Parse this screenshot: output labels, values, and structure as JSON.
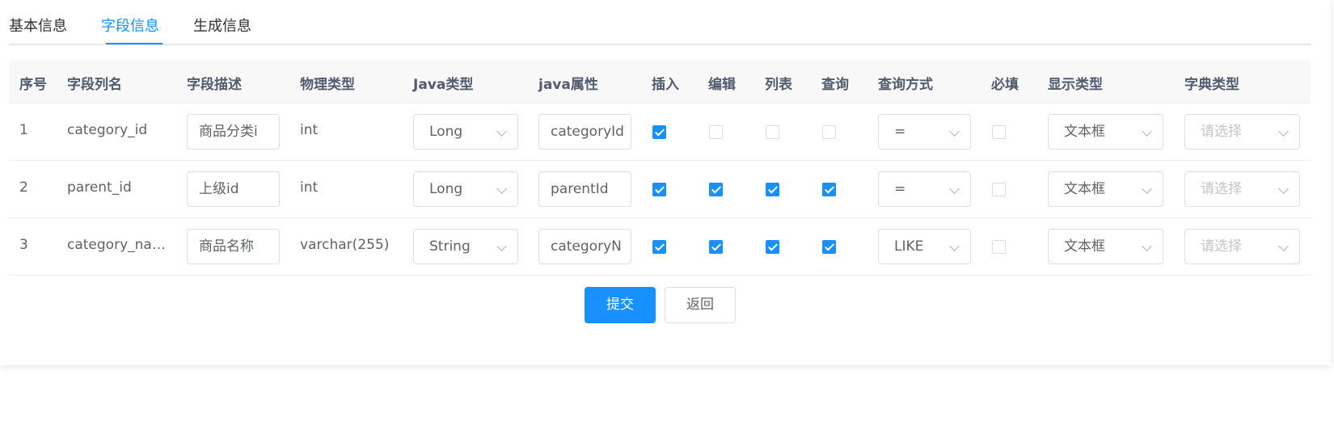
{
  "tabs": [
    {
      "label": "基本信息",
      "active": false
    },
    {
      "label": "字段信息",
      "active": true
    },
    {
      "label": "生成信息",
      "active": false
    }
  ],
  "colors": {
    "accent": "#1890ff",
    "header_bg": "#f8f8f9",
    "border": "#dcdfe6",
    "placeholder": "#c0c4cc"
  },
  "table": {
    "headers": [
      "序号",
      "字段列名",
      "字段描述",
      "物理类型",
      "Java类型",
      "java属性",
      "插入",
      "编辑",
      "列表",
      "查询",
      "查询方式",
      "必填",
      "显示类型",
      "字典类型"
    ],
    "rows": [
      {
        "index": "1",
        "column_name": "category_id",
        "description": "商品分类i",
        "physical_type": "int",
        "java_type": "Long",
        "java_field": "categoryId",
        "insert": true,
        "edit": false,
        "list": false,
        "query": false,
        "query_type": "=",
        "required": false,
        "display_type": "文本框",
        "dict_type_placeholder": "请选择"
      },
      {
        "index": "2",
        "column_name": "parent_id",
        "description": "上级id",
        "physical_type": "int",
        "java_type": "Long",
        "java_field": "parentId",
        "insert": true,
        "edit": true,
        "list": true,
        "query": true,
        "query_type": "=",
        "required": false,
        "display_type": "文本框",
        "dict_type_placeholder": "请选择"
      },
      {
        "index": "3",
        "column_name": "category_na…",
        "description": "商品名称",
        "physical_type": "varchar(255)",
        "java_type": "String",
        "java_field": "categoryN",
        "insert": true,
        "edit": true,
        "list": true,
        "query": true,
        "query_type": "LIKE",
        "required": false,
        "display_type": "文本框",
        "dict_type_placeholder": "请选择"
      }
    ]
  },
  "buttons": {
    "submit_label": "提交",
    "back_label": "返回"
  },
  "icons": {
    "select_arrow": "chevron-down-icon",
    "checkbox_check": "check-icon"
  }
}
